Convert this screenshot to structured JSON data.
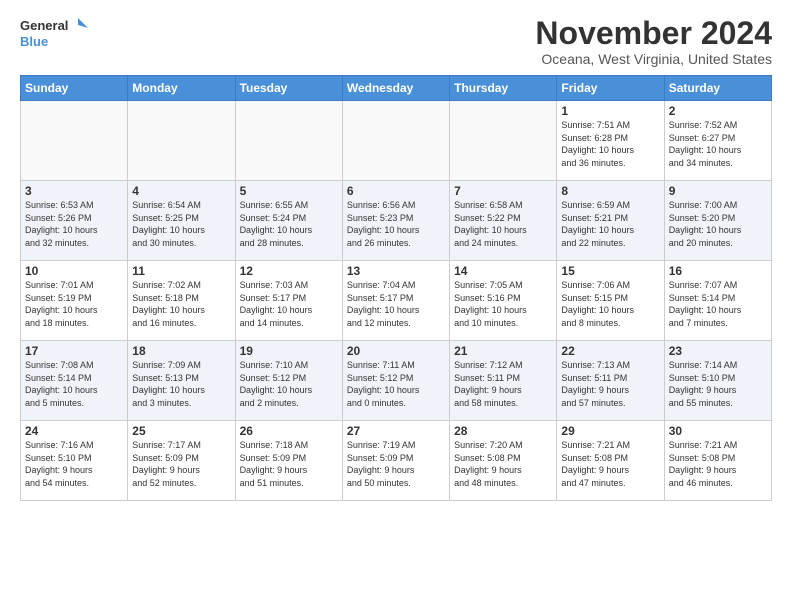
{
  "header": {
    "logo_line1": "General",
    "logo_line2": "Blue",
    "month": "November 2024",
    "location": "Oceana, West Virginia, United States"
  },
  "days_of_week": [
    "Sunday",
    "Monday",
    "Tuesday",
    "Wednesday",
    "Thursday",
    "Friday",
    "Saturday"
  ],
  "weeks": [
    [
      {
        "day": "",
        "info": ""
      },
      {
        "day": "",
        "info": ""
      },
      {
        "day": "",
        "info": ""
      },
      {
        "day": "",
        "info": ""
      },
      {
        "day": "",
        "info": ""
      },
      {
        "day": "1",
        "info": "Sunrise: 7:51 AM\nSunset: 6:28 PM\nDaylight: 10 hours\nand 36 minutes."
      },
      {
        "day": "2",
        "info": "Sunrise: 7:52 AM\nSunset: 6:27 PM\nDaylight: 10 hours\nand 34 minutes."
      }
    ],
    [
      {
        "day": "3",
        "info": "Sunrise: 6:53 AM\nSunset: 5:26 PM\nDaylight: 10 hours\nand 32 minutes."
      },
      {
        "day": "4",
        "info": "Sunrise: 6:54 AM\nSunset: 5:25 PM\nDaylight: 10 hours\nand 30 minutes."
      },
      {
        "day": "5",
        "info": "Sunrise: 6:55 AM\nSunset: 5:24 PM\nDaylight: 10 hours\nand 28 minutes."
      },
      {
        "day": "6",
        "info": "Sunrise: 6:56 AM\nSunset: 5:23 PM\nDaylight: 10 hours\nand 26 minutes."
      },
      {
        "day": "7",
        "info": "Sunrise: 6:58 AM\nSunset: 5:22 PM\nDaylight: 10 hours\nand 24 minutes."
      },
      {
        "day": "8",
        "info": "Sunrise: 6:59 AM\nSunset: 5:21 PM\nDaylight: 10 hours\nand 22 minutes."
      },
      {
        "day": "9",
        "info": "Sunrise: 7:00 AM\nSunset: 5:20 PM\nDaylight: 10 hours\nand 20 minutes."
      }
    ],
    [
      {
        "day": "10",
        "info": "Sunrise: 7:01 AM\nSunset: 5:19 PM\nDaylight: 10 hours\nand 18 minutes."
      },
      {
        "day": "11",
        "info": "Sunrise: 7:02 AM\nSunset: 5:18 PM\nDaylight: 10 hours\nand 16 minutes."
      },
      {
        "day": "12",
        "info": "Sunrise: 7:03 AM\nSunset: 5:17 PM\nDaylight: 10 hours\nand 14 minutes."
      },
      {
        "day": "13",
        "info": "Sunrise: 7:04 AM\nSunset: 5:17 PM\nDaylight: 10 hours\nand 12 minutes."
      },
      {
        "day": "14",
        "info": "Sunrise: 7:05 AM\nSunset: 5:16 PM\nDaylight: 10 hours\nand 10 minutes."
      },
      {
        "day": "15",
        "info": "Sunrise: 7:06 AM\nSunset: 5:15 PM\nDaylight: 10 hours\nand 8 minutes."
      },
      {
        "day": "16",
        "info": "Sunrise: 7:07 AM\nSunset: 5:14 PM\nDaylight: 10 hours\nand 7 minutes."
      }
    ],
    [
      {
        "day": "17",
        "info": "Sunrise: 7:08 AM\nSunset: 5:14 PM\nDaylight: 10 hours\nand 5 minutes."
      },
      {
        "day": "18",
        "info": "Sunrise: 7:09 AM\nSunset: 5:13 PM\nDaylight: 10 hours\nand 3 minutes."
      },
      {
        "day": "19",
        "info": "Sunrise: 7:10 AM\nSunset: 5:12 PM\nDaylight: 10 hours\nand 2 minutes."
      },
      {
        "day": "20",
        "info": "Sunrise: 7:11 AM\nSunset: 5:12 PM\nDaylight: 10 hours\nand 0 minutes."
      },
      {
        "day": "21",
        "info": "Sunrise: 7:12 AM\nSunset: 5:11 PM\nDaylight: 9 hours\nand 58 minutes."
      },
      {
        "day": "22",
        "info": "Sunrise: 7:13 AM\nSunset: 5:11 PM\nDaylight: 9 hours\nand 57 minutes."
      },
      {
        "day": "23",
        "info": "Sunrise: 7:14 AM\nSunset: 5:10 PM\nDaylight: 9 hours\nand 55 minutes."
      }
    ],
    [
      {
        "day": "24",
        "info": "Sunrise: 7:16 AM\nSunset: 5:10 PM\nDaylight: 9 hours\nand 54 minutes."
      },
      {
        "day": "25",
        "info": "Sunrise: 7:17 AM\nSunset: 5:09 PM\nDaylight: 9 hours\nand 52 minutes."
      },
      {
        "day": "26",
        "info": "Sunrise: 7:18 AM\nSunset: 5:09 PM\nDaylight: 9 hours\nand 51 minutes."
      },
      {
        "day": "27",
        "info": "Sunrise: 7:19 AM\nSunset: 5:09 PM\nDaylight: 9 hours\nand 50 minutes."
      },
      {
        "day": "28",
        "info": "Sunrise: 7:20 AM\nSunset: 5:08 PM\nDaylight: 9 hours\nand 48 minutes."
      },
      {
        "day": "29",
        "info": "Sunrise: 7:21 AM\nSunset: 5:08 PM\nDaylight: 9 hours\nand 47 minutes."
      },
      {
        "day": "30",
        "info": "Sunrise: 7:21 AM\nSunset: 5:08 PM\nDaylight: 9 hours\nand 46 minutes."
      }
    ]
  ]
}
